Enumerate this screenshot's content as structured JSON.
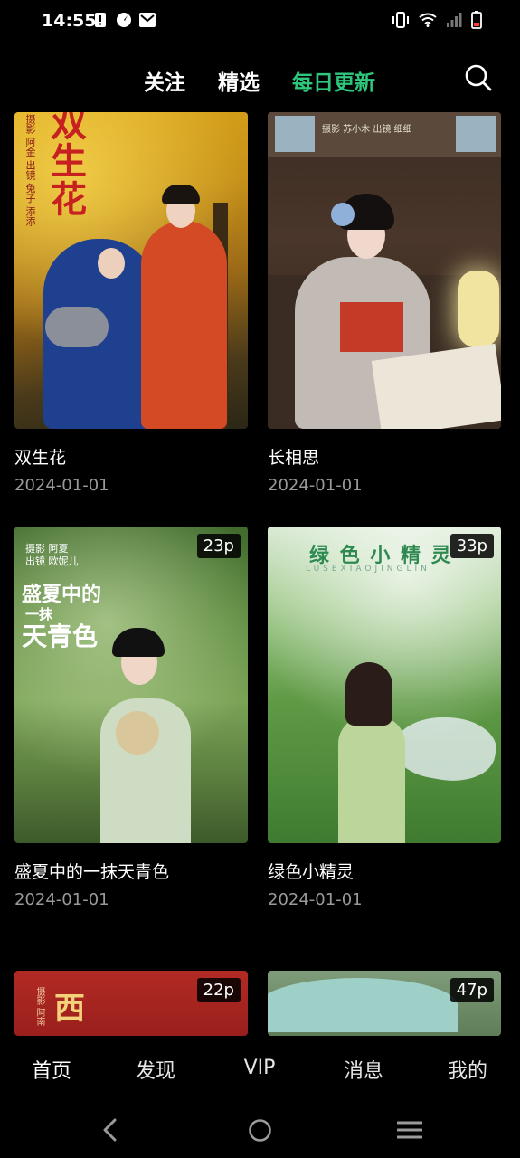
{
  "status": {
    "time": "14:55",
    "icons": [
      "alert-icon",
      "compass-icon",
      "mail-icon",
      "vibrate-icon",
      "wifi-icon",
      "signal-icon",
      "battery-icon"
    ]
  },
  "top_tabs": [
    {
      "label": "关注",
      "active": false
    },
    {
      "label": "精选",
      "active": false
    },
    {
      "label": "每日更新",
      "active": true
    }
  ],
  "colors": {
    "accent": "#2ec77c",
    "background": "#000000",
    "date": "#9a9a9a"
  },
  "cards": [
    {
      "title": "双生花",
      "date": "2024-01-01",
      "badge": "",
      "overlay": [
        "双",
        "生",
        "花"
      ],
      "overlay_small": [
        "摄影 阿金",
        "出镜 兔子 添添"
      ]
    },
    {
      "title": "长相思",
      "date": "2024-01-01",
      "badge": "",
      "overlay_small": [
        "摄影 苏小木  出镜 细细"
      ]
    },
    {
      "title": "盛夏中的一抹天青色",
      "date": "2024-01-01",
      "badge": "23p",
      "overlay": [
        "盛夏中的",
        "一抹",
        "天青色"
      ],
      "overlay_small": [
        "摄影 阿夏",
        "出镜 欧妮儿"
      ]
    },
    {
      "title": "绿色小精灵",
      "date": "2024-01-01",
      "badge": "33p",
      "overlay": [
        "绿 色 小 精 灵"
      ],
      "overlay_small": [
        "LUSEXIAOJINGLIN"
      ]
    },
    {
      "title": "",
      "date": "",
      "badge": "22p",
      "overlay": [
        "西"
      ],
      "overlay_small": [
        "摄影 阿南"
      ]
    },
    {
      "title": "",
      "date": "",
      "badge": "47p"
    }
  ],
  "bottom_nav": [
    {
      "label": "首页",
      "active": true
    },
    {
      "label": "发现",
      "active": false
    },
    {
      "label": "VIP",
      "active": false
    },
    {
      "label": "消息",
      "active": false
    },
    {
      "label": "我的",
      "active": false
    }
  ],
  "system_nav": [
    "back-icon",
    "home-icon",
    "menu-icon"
  ]
}
